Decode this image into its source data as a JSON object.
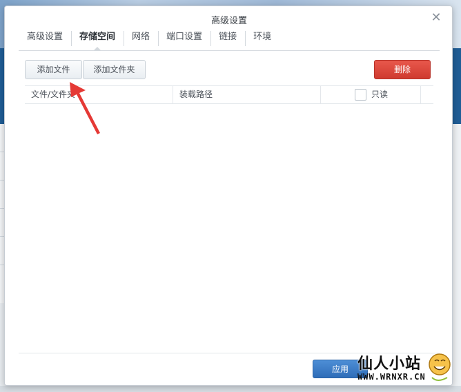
{
  "dialog": {
    "title": "高级设置",
    "close_icon": "close-icon"
  },
  "tabs": [
    {
      "label": "高级设置",
      "active": false
    },
    {
      "label": "存储空间",
      "active": true
    },
    {
      "label": "网络",
      "active": false
    },
    {
      "label": "端口设置",
      "active": false
    },
    {
      "label": "链接",
      "active": false
    },
    {
      "label": "环境",
      "active": false
    }
  ],
  "toolbar": {
    "add_file_label": "添加文件",
    "add_folder_label": "添加文件夹",
    "delete_label": "删除"
  },
  "table": {
    "columns": {
      "name": "文件/文件夹",
      "mount_path": "装载路径",
      "read_only": "只读"
    },
    "rows": []
  },
  "footer": {
    "apply_label": "应用"
  },
  "watermark": {
    "text": "仙人小站",
    "url": "WWW.WRNXR.CN"
  },
  "colors": {
    "delete_button": "#cf3a2f",
    "apply_button": "#2f6db8",
    "annotation_arrow": "#e53935"
  }
}
